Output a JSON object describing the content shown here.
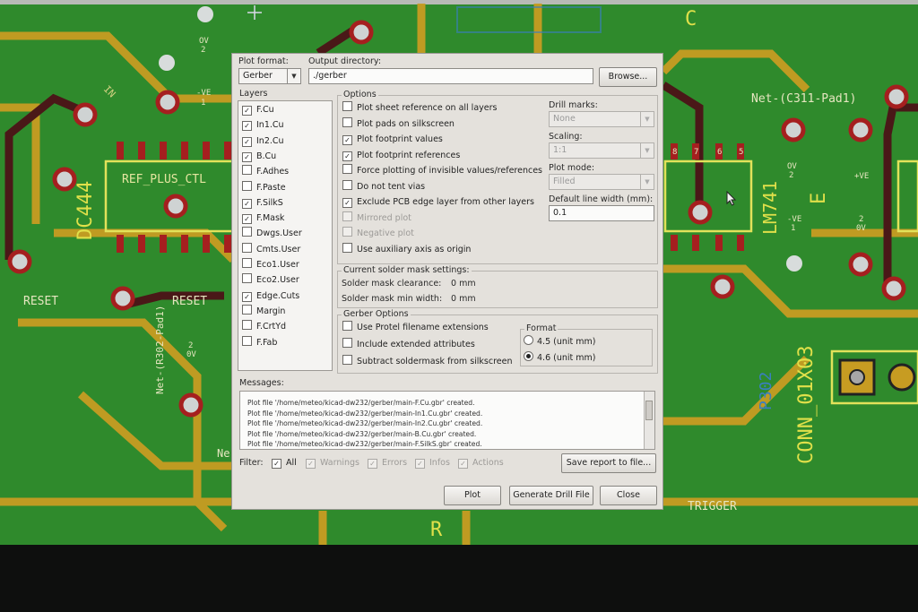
{
  "pcb": {
    "labels": {
      "ref_plus": "REF_PLUS_CTL",
      "dc444": "DC444",
      "reset1": "RESET",
      "reset2": "RESET",
      "net_r302": "Net-(R302-Pad1)",
      "net_c311": "Net-(C311-Pad1)",
      "lm741": "LM741",
      "conn": "CONN_01X03",
      "p302": "P302",
      "trigger": "TRIGGER",
      "r": "R",
      "c": "C",
      "ne": "Ne",
      "in": "IN",
      "ov1": "OV",
      "ov_two": "2",
      "ve1": "-VE",
      "ve1_num": "1",
      "ov2": "2",
      "ov2b": "0V",
      "ve_right": "-VE",
      "ve_right_num": "1",
      "ov_right": "2",
      "ov_right2": "0V",
      "ov_top": "OV",
      "ov_top_num": "2",
      "ve_plus": "+VE",
      "pin_nums": [
        "8",
        "7",
        "6",
        "5"
      ],
      "e_mark": "E"
    },
    "colors": {
      "board": "#2e8b2a",
      "track": "#c9a024",
      "silk": "#e8e850",
      "pad_ring": "#a01c1c",
      "pad": "#cfd3d3"
    }
  },
  "dialog": {
    "plot_format": {
      "label": "Plot format:",
      "value": "Gerber"
    },
    "output_directory": {
      "label": "Output directory:",
      "value": "./gerber",
      "browse": "Browse..."
    },
    "layers": {
      "title": "Layers",
      "items": [
        {
          "name": "F.Cu",
          "checked": "✓"
        },
        {
          "name": "In1.Cu",
          "checked": "✓"
        },
        {
          "name": "In2.Cu",
          "checked": "✓"
        },
        {
          "name": "B.Cu",
          "checked": "✓"
        },
        {
          "name": "F.Adhes",
          "checked": ""
        },
        {
          "name": "F.Paste",
          "checked": ""
        },
        {
          "name": "F.SilkS",
          "checked": "✓"
        },
        {
          "name": "F.Mask",
          "checked": "✓"
        },
        {
          "name": "Dwgs.User",
          "checked": ""
        },
        {
          "name": "Cmts.User",
          "checked": ""
        },
        {
          "name": "Eco1.User",
          "checked": ""
        },
        {
          "name": "Eco2.User",
          "checked": ""
        },
        {
          "name": "Edge.Cuts",
          "checked": "✓"
        },
        {
          "name": "Margin",
          "checked": ""
        },
        {
          "name": "F.CrtYd",
          "checked": ""
        },
        {
          "name": "F.Fab",
          "checked": ""
        }
      ]
    },
    "options": {
      "title": "Options",
      "items": [
        {
          "label": "Plot sheet reference on all layers",
          "checked": "",
          "disabled": false
        },
        {
          "label": "Plot pads on silkscreen",
          "checked": "",
          "disabled": false
        },
        {
          "label": "Plot footprint values",
          "checked": "✓",
          "disabled": false
        },
        {
          "label": "Plot footprint references",
          "checked": "✓",
          "disabled": false
        },
        {
          "label": "Force plotting of invisible values/references",
          "checked": "",
          "disabled": false
        },
        {
          "label": "Do not tent vias",
          "checked": "",
          "disabled": false
        },
        {
          "label": "Exclude PCB edge layer from other layers",
          "checked": "✓",
          "disabled": false
        },
        {
          "label": "Mirrored plot",
          "checked": "",
          "disabled": true
        },
        {
          "label": "Negative plot",
          "checked": "",
          "disabled": true
        },
        {
          "label": "Use auxiliary axis as origin",
          "checked": "",
          "disabled": false
        }
      ],
      "drill_marks": {
        "label": "Drill marks:",
        "value": "None"
      },
      "scaling": {
        "label": "Scaling:",
        "value": "1:1"
      },
      "plot_mode": {
        "label": "Plot mode:",
        "value": "Filled"
      },
      "line_width": {
        "label": "Default line width (mm):",
        "value": "0.1"
      }
    },
    "solder_mask": {
      "title": "Current solder mask settings:",
      "clearance_label": "Solder mask clearance:",
      "clearance_value": "0 mm",
      "min_width_label": "Solder mask min width:",
      "min_width_value": "0 mm"
    },
    "gerber_options": {
      "title": "Gerber Options",
      "items": [
        {
          "label": "Use Protel filename extensions",
          "checked": ""
        },
        {
          "label": "Include extended attributes",
          "checked": ""
        },
        {
          "label": "Subtract soldermask from silkscreen",
          "checked": ""
        }
      ],
      "format": {
        "title": "Format",
        "options": [
          {
            "label": "4.5 (unit mm)",
            "selected": false
          },
          {
            "label": "4.6 (unit mm)",
            "selected": true
          }
        ]
      }
    },
    "messages": {
      "title": "Messages:",
      "lines": [
        "Plot file '/home/meteo/kicad-dw232/gerber/main-F.Cu.gbr' created.",
        "Plot file '/home/meteo/kicad-dw232/gerber/main-In1.Cu.gbr' created.",
        "Plot file '/home/meteo/kicad-dw232/gerber/main-In2.Cu.gbr' created.",
        "Plot file '/home/meteo/kicad-dw232/gerber/main-B.Cu.gbr' created.",
        "Plot file '/home/meteo/kicad-dw232/gerber/main-F.SilkS.gbr' created."
      ]
    },
    "filter": {
      "label": "Filter:",
      "items": [
        {
          "label": "All",
          "checked": "✓",
          "disabled": false
        },
        {
          "label": "Warnings",
          "checked": "✓",
          "disabled": true
        },
        {
          "label": "Errors",
          "checked": "✓",
          "disabled": true
        },
        {
          "label": "Infos",
          "checked": "✓",
          "disabled": true
        },
        {
          "label": "Actions",
          "checked": "✓",
          "disabled": true
        }
      ],
      "save_report": "Save report to file..."
    },
    "buttons": {
      "plot": "Plot",
      "drill": "Generate Drill File",
      "close": "Close"
    }
  }
}
